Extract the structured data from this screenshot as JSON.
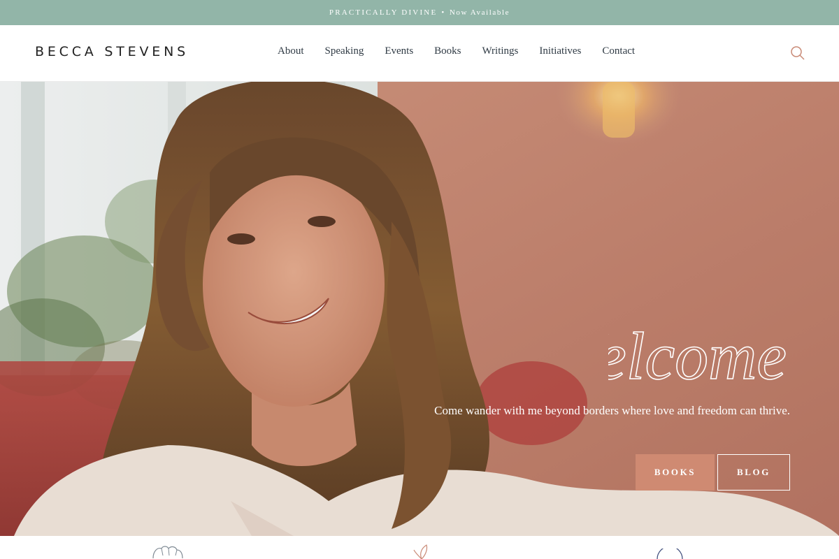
{
  "announcement": {
    "title": "PRACTICALLY DIVINE",
    "separator": "•",
    "status": "Now Available"
  },
  "header": {
    "logo": "BECCA STEVENS",
    "nav": [
      "About",
      "Speaking",
      "Events",
      "Books",
      "Writings",
      "Initiatives",
      "Contact"
    ],
    "search_icon": "search-icon"
  },
  "hero": {
    "welcome_script": "Welcome",
    "tagline": "Come wander with me beyond borders where love and freedom can thrive.",
    "buttons": {
      "books": "BOOKS",
      "blog": "BLOG"
    }
  },
  "strip_icons": [
    "hands-icon",
    "leaf-icon",
    "circle-icon"
  ],
  "colors": {
    "announcement_bg": "#92b5a8",
    "accent": "#cf8a72",
    "wall": "#c98a76"
  }
}
